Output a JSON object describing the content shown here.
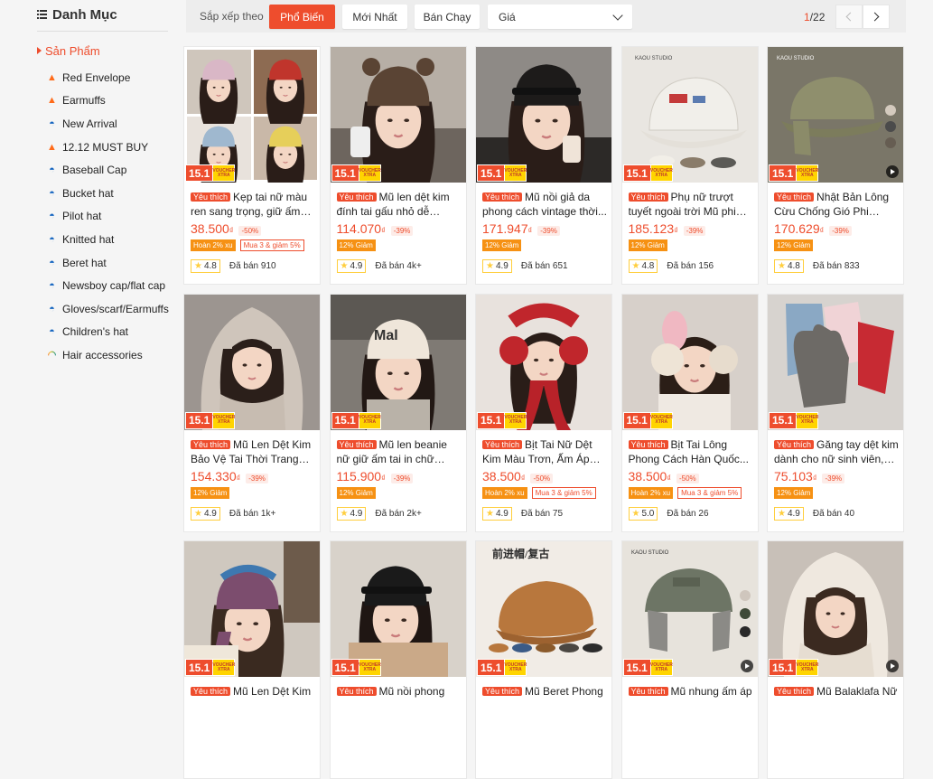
{
  "sidebar": {
    "title": "Danh Mục",
    "active": "Sản Phẩm",
    "categories": [
      {
        "label": "Red Envelope",
        "icon": "fire-icon"
      },
      {
        "label": "Earmuffs",
        "icon": "fire-icon"
      },
      {
        "label": "New Arrival",
        "icon": "cap-icon"
      },
      {
        "label": "12.12 MUST BUY",
        "icon": "fire-icon"
      },
      {
        "label": "Baseball Cap",
        "icon": "cap-icon"
      },
      {
        "label": "Bucket hat",
        "icon": "cap-icon"
      },
      {
        "label": "Pilot hat",
        "icon": "cap-icon"
      },
      {
        "label": "Knitted hat",
        "icon": "cap-icon"
      },
      {
        "label": "Beret hat",
        "icon": "cap-icon"
      },
      {
        "label": "Newsboy cap/flat cap",
        "icon": "cap-icon"
      },
      {
        "label": "Gloves/scarf/Earmuffs",
        "icon": "cap-icon"
      },
      {
        "label": "Children's hat",
        "icon": "cap-icon"
      },
      {
        "label": "Hair accessories",
        "icon": "rainbow-icon"
      }
    ]
  },
  "sort": {
    "label": "Sắp xếp theo",
    "popular": "Phổ Biến",
    "latest": "Mới Nhất",
    "top_sales": "Bán Chạy",
    "price": "Giá"
  },
  "pager": {
    "current": "1",
    "total": "/22"
  },
  "badge": {
    "event": "15.1",
    "voucher_top": "VOUCHER",
    "voucher_bottom": "XTRA"
  },
  "colors": {
    "accent": "#ee4d2d",
    "tag_fill": "#f69113",
    "voucher": "#ffd400",
    "star": "#ffce3d"
  },
  "currency": "₫",
  "pref_label": "Yêu thích",
  "products": [
    {
      "name": "Kẹp tai nữ màu ren sang trọng, giữ ấm c...",
      "price": "38.500",
      "discount": "-50%",
      "tags": [
        "Hoàn 2% xu",
        "Mua 3 & giảm 5%"
      ],
      "rating": "4.8",
      "sold": "Đã bán 910"
    },
    {
      "name": "Mũ len dệt kim đính tai gấu nhỏ dễ thươ...",
      "price": "114.070",
      "discount": "-39%",
      "tags": [
        "12% Giảm"
      ],
      "rating": "4.9",
      "sold": "Đã bán 4k+"
    },
    {
      "name": "Mũ nồi giả da phong cách vintage thời...",
      "price": "171.947",
      "discount": "-39%",
      "tags": [
        "12% Giảm"
      ],
      "rating": "4.9",
      "sold": "Đã bán 651"
    },
    {
      "name": "Phụ nữ trượt tuyết ngoài trời Mũ phi công m...",
      "price": "185.123",
      "discount": "-39%",
      "tags": [
        "12% Giảm"
      ],
      "rating": "4.8",
      "sold": "Đã bán 156"
    },
    {
      "name": "Nhật Bản Lông Cừu Chống Gió Phi Côn...",
      "price": "170.629",
      "discount": "-39%",
      "tags": [
        "12% Giảm"
      ],
      "rating": "4.8",
      "sold": "Đã bán 833"
    },
    {
      "name": "Mũ Len Dệt Kim Bảo Vệ Tai Thời Trang M...",
      "price": "154.330",
      "discount": "-39%",
      "tags": [
        "12% Giảm"
      ],
      "rating": "4.9",
      "sold": "Đã bán 1k+"
    },
    {
      "name": "Mũ len beanie nữ giữ ấm tai in chữ phong...",
      "price": "115.900",
      "discount": "-39%",
      "tags": [
        "12% Giảm"
      ],
      "rating": "4.9",
      "sold": "Đã bán 2k+"
    },
    {
      "name": "Bịt Tai Nữ Dệt Kim Màu Trơn, Ấm Áp Mùa...",
      "price": "38.500",
      "discount": "-50%",
      "tags": [
        "Hoàn 2% xu",
        "Mua 3 & giảm 5%"
      ],
      "rating": "4.9",
      "sold": "Đã bán 75"
    },
    {
      "name": "Bịt Tai Lông Phong Cách Hàn Quốc...",
      "price": "38.500",
      "discount": "-50%",
      "tags": [
        "Hoàn 2% xu",
        "Mua 3 & giảm 5%"
      ],
      "rating": "5.0",
      "sold": "Đã bán 26"
    },
    {
      "name": "Găng tay dệt kim dành cho nữ sinh viên, p...",
      "price": "75.103",
      "discount": "-39%",
      "tags": [
        "12% Giảm"
      ],
      "rating": "4.9",
      "sold": "Đã bán 40"
    },
    {
      "name": "Mũ Len Dệt Kim",
      "price": "",
      "discount": "",
      "tags": [],
      "rating": "",
      "sold": ""
    },
    {
      "name": "Mũ nồi phong",
      "price": "",
      "discount": "",
      "tags": [],
      "rating": "",
      "sold": ""
    },
    {
      "name": "Mũ Beret Phong",
      "price": "",
      "discount": "",
      "tags": [],
      "rating": "",
      "sold": ""
    },
    {
      "name": "Mũ nhung ấm áp",
      "price": "",
      "discount": "",
      "tags": [],
      "rating": "",
      "sold": ""
    },
    {
      "name": "Mũ Balaklafa Nữ",
      "price": "",
      "discount": "",
      "tags": [],
      "rating": "",
      "sold": ""
    }
  ],
  "thumbs": [
    {
      "kind": "collage"
    },
    {
      "kind": "bear"
    },
    {
      "kind": "leatherberet"
    },
    {
      "kind": "whitecap"
    },
    {
      "kind": "olivecap",
      "video": true
    },
    {
      "kind": "hood"
    },
    {
      "kind": "beanie"
    },
    {
      "kind": "redearmuff"
    },
    {
      "kind": "pinkearmuff"
    },
    {
      "kind": "gloves"
    },
    {
      "kind": "patchwork"
    },
    {
      "kind": "newsboy"
    },
    {
      "kind": "camelberet"
    },
    {
      "kind": "trapper",
      "video": true
    },
    {
      "kind": "balaclava",
      "video": true
    }
  ]
}
